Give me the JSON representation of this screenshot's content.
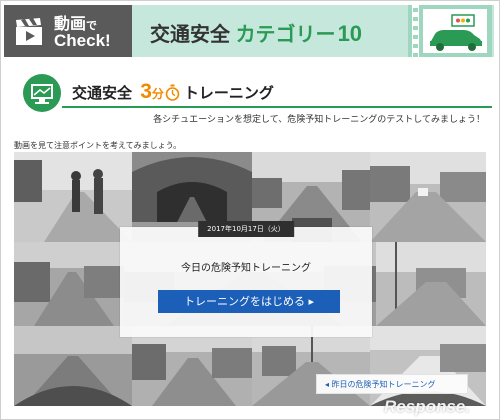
{
  "banner": {
    "video_label": "動画",
    "de_label": "で",
    "check_label": "Check!",
    "title_prefix": "交通安全",
    "title_category": "カテゴリー",
    "title_number": "10",
    "colors": {
      "dark": "#5a5a5a",
      "mint": "#c6e8dc",
      "green": "#2a9a54"
    }
  },
  "section": {
    "title_prefix": "交通安全",
    "title_number": "3",
    "title_unit": "分",
    "title_suffix": "トレーニング",
    "subtitle": "各シチュエーションを想定して、危険予知トレーニングのテストしてみましょう！",
    "accent_color": "#f08a00"
  },
  "instruction": "動画を見て注意ポイントを考えてみましょう。",
  "modal": {
    "date": "2017年10月17日（火）",
    "title": "今日の危険予知トレーニング",
    "start_button": "トレーニングをはじめる ▸"
  },
  "prev_button": "◂ 昨日の危険予知トレーニング",
  "watermark": "Response."
}
